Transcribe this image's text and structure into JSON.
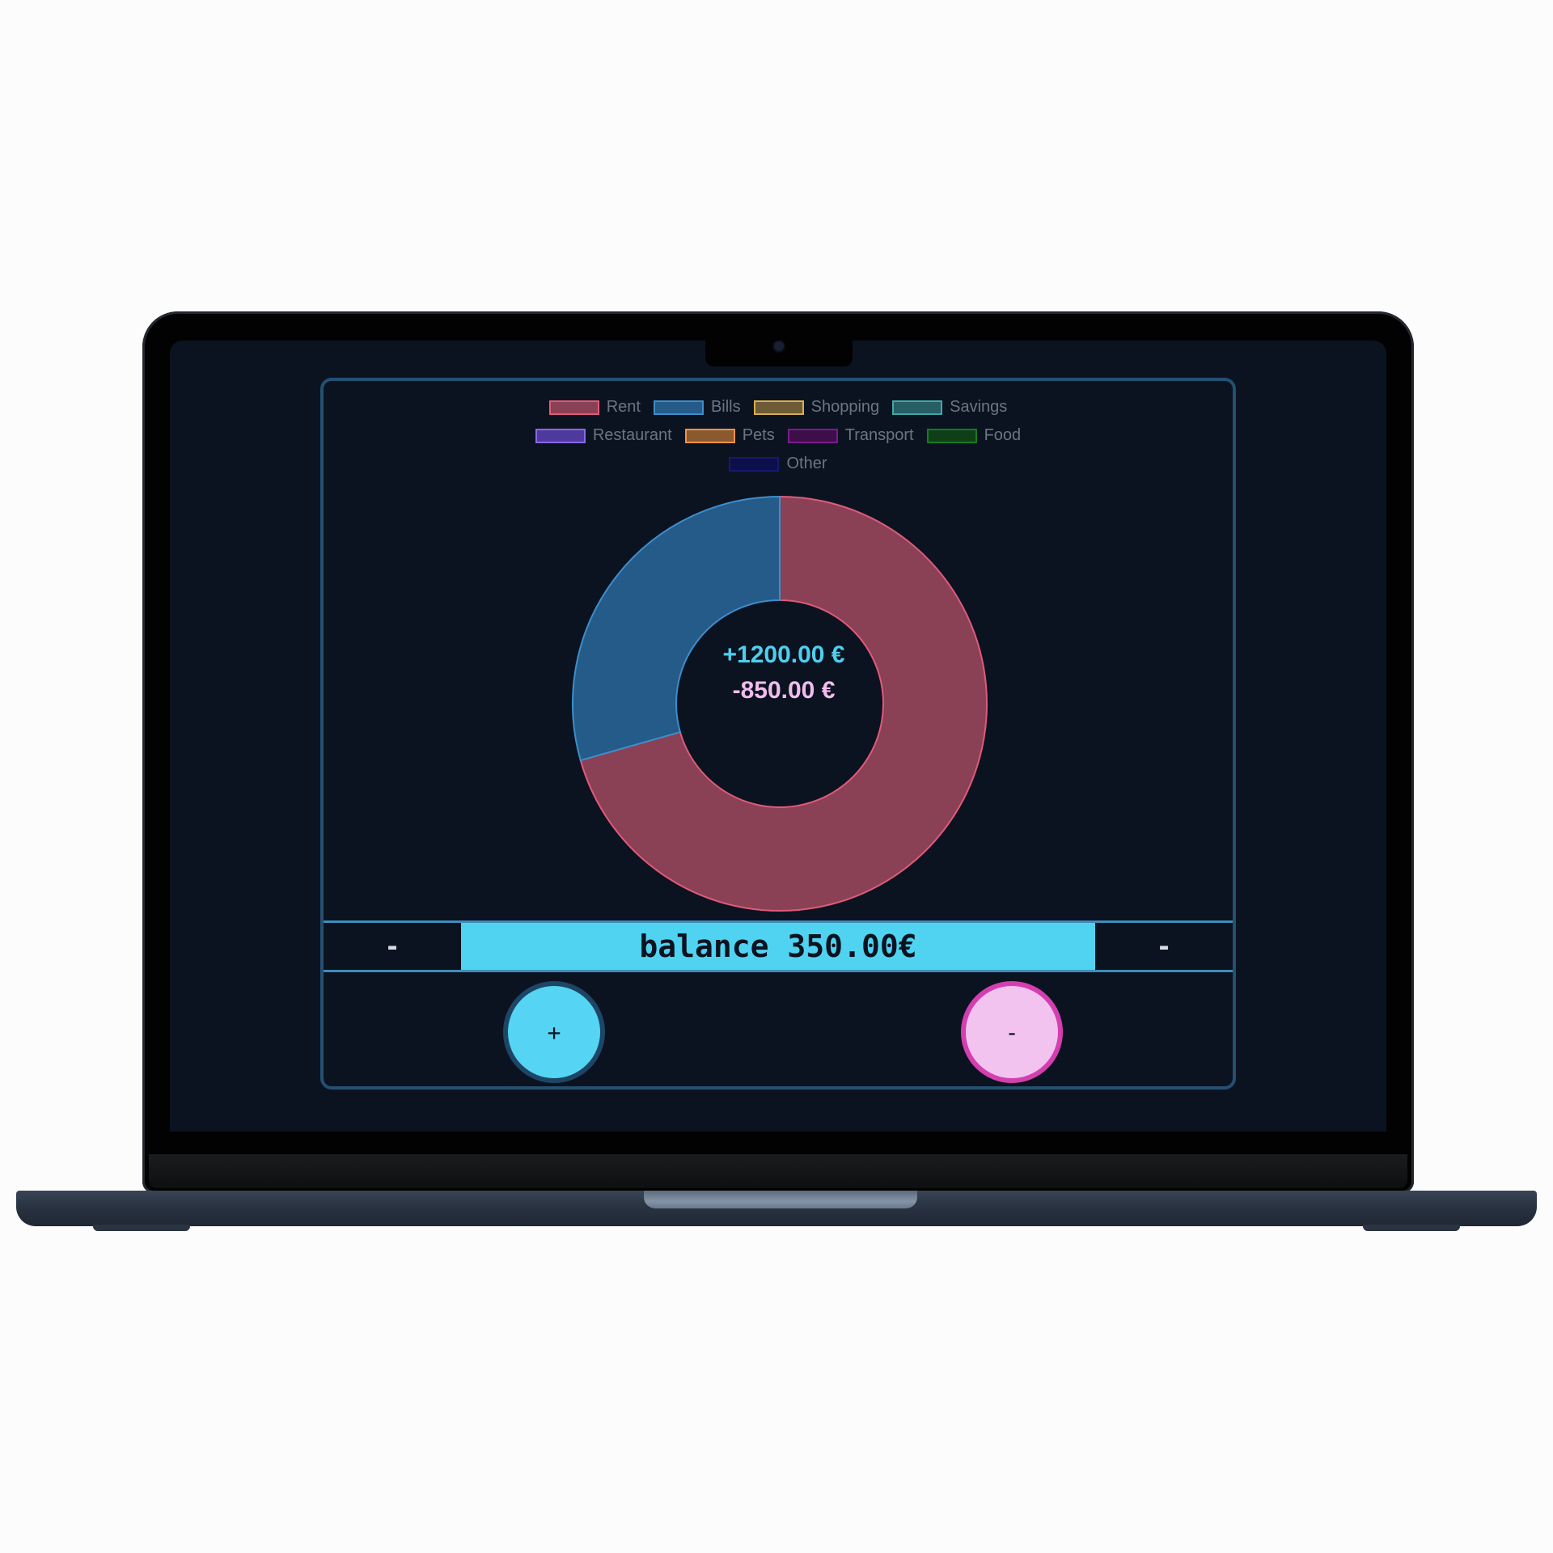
{
  "legend": [
    {
      "label": "Rent",
      "fill": "#8a4055",
      "stroke": "#e05a7a"
    },
    {
      "label": "Bills",
      "fill": "#245b88",
      "stroke": "#3d8dcc"
    },
    {
      "label": "Shopping",
      "fill": "#6d5a37",
      "stroke": "#d9b04f"
    },
    {
      "label": "Savings",
      "fill": "#265e63",
      "stroke": "#3fa8a8"
    },
    {
      "label": "Restaurant",
      "fill": "#4d3a9c",
      "stroke": "#8a68e6"
    },
    {
      "label": "Pets",
      "fill": "#8a5a2e",
      "stroke": "#f0924a"
    },
    {
      "label": "Transport",
      "fill": "#3e0e4a",
      "stroke": "#7a1c8c"
    },
    {
      "label": "Food",
      "fill": "#0f3f17",
      "stroke": "#157a25"
    },
    {
      "label": "Other",
      "fill": "#0d0f4a",
      "stroke": "#141a70"
    }
  ],
  "chart_data": {
    "type": "pie",
    "labels": [
      "Rent",
      "Bills",
      "Shopping",
      "Savings",
      "Restaurant",
      "Pets",
      "Transport",
      "Food",
      "Other"
    ],
    "values": [
      600,
      250,
      0,
      0,
      0,
      0,
      0,
      0,
      0
    ]
  },
  "summary": {
    "income": "+1200.00 €",
    "expense": "-850.00 €"
  },
  "balance_bar": {
    "left": "-",
    "label": "balance 350.00€",
    "right": "-"
  },
  "buttons": {
    "add": "+",
    "subtract": "-"
  },
  "colors": {
    "accent": "#4fd3f1",
    "expense_accent": "#f2c3ef",
    "border": "#245072",
    "background": "#0c1320"
  }
}
